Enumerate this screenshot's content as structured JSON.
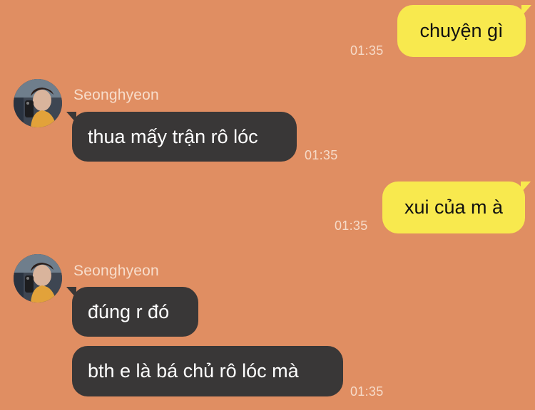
{
  "messages": [
    {
      "from": "me",
      "text": "chuyện gì",
      "time": "01:35"
    },
    {
      "from": "Seonghyeon",
      "sender_label": "Seonghyeon",
      "text": "thua mấy trận rô lóc",
      "time": "01:35"
    },
    {
      "from": "me",
      "text": "xui của m à",
      "time": "01:35"
    },
    {
      "from": "Seonghyeon",
      "sender_label": "Seonghyeon",
      "text": "đúng r đó"
    },
    {
      "from": "Seonghyeon",
      "text": "bth e là bá chủ rô lóc mà",
      "time": "01:35"
    }
  ],
  "colors": {
    "background": "#E08E62",
    "outgoing_bubble": "#F8E94E",
    "incoming_bubble": "#393737"
  }
}
